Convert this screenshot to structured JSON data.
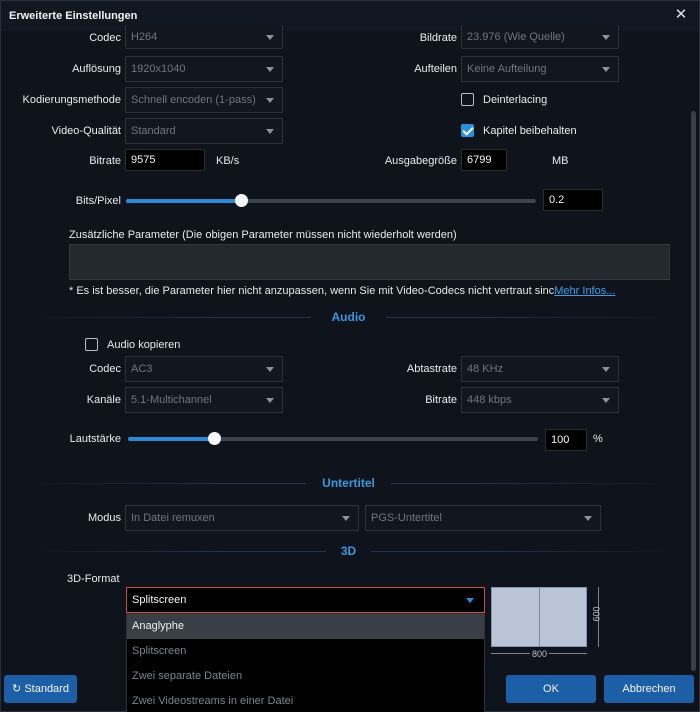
{
  "window": {
    "title": "Erweiterte Einstellungen",
    "close": "✕"
  },
  "video": {
    "codec_label": "Codec",
    "codec_value": "H264",
    "framerate_label": "Bildrate",
    "framerate_value": "23.976 (Wie Quelle)",
    "resolution_label": "Auflösung",
    "resolution_value": "1920x1040",
    "split_label": "Aufteilen",
    "split_value": "Keine Aufteilung",
    "encoding_label": "Kodierungsmethode",
    "encoding_value": "Schnell encoden (1-pass)",
    "deinterlacing_label": "Deinterlacing",
    "deinterlacing_checked": false,
    "quality_label": "Video-Qualität",
    "quality_value": "Standard",
    "chapters_label": "Kapitel beibehalten",
    "chapters_checked": true,
    "bitrate_label": "Bitrate",
    "bitrate_value": "9575",
    "bitrate_unit": "KB/s",
    "outsize_label": "Ausgabegröße",
    "outsize_value": "6799",
    "outsize_unit": "MB",
    "bpp_label": "Bits/Pixel",
    "bpp_value": "0.2",
    "bpp_fraction": 0.28,
    "params_label": "Zusätzliche Parameter (Die obigen Parameter müssen nicht wiederholt werden)",
    "note": "* Es ist besser, die Parameter hier nicht anzupassen, wenn Sie mit Video-Codecs nicht vertraut sinc",
    "more_info": "Mehr Infos..."
  },
  "audio": {
    "section": "Audio",
    "copy_label": "Audio kopieren",
    "copy_checked": false,
    "codec_label": "Codec",
    "codec_value": "AC3",
    "samplerate_label": "Abtastrate",
    "samplerate_value": "48 KHz",
    "channels_label": "Kanäle",
    "channels_value": "5.1-Multichannel",
    "bitrate_label": "Bitrate",
    "bitrate_value": "448 kbps",
    "volume_label": "Lautstärke",
    "volume_value": "100",
    "volume_unit": "%",
    "volume_fraction": 0.21
  },
  "subtitle": {
    "section": "Untertitel",
    "mode_label": "Modus",
    "mode_value": "In Datei remuxen",
    "format_value": "PGS-Untertitel"
  },
  "three_d": {
    "section": "3D",
    "format_label": "3D-Format",
    "selected": "Splitscreen",
    "options": [
      "Anaglyphe",
      "Splitscreen",
      "Zwei separate Dateien",
      "Zwei Videostreams in einer Datei"
    ],
    "preview_width": "800",
    "preview_height": "600"
  },
  "buttons": {
    "standard": "Standard",
    "ok": "OK",
    "cancel": "Abbrechen"
  },
  "colors": {
    "accent": "#2b8bd6",
    "button": "#1d5fa6",
    "highlight_border": "#d04a44"
  }
}
